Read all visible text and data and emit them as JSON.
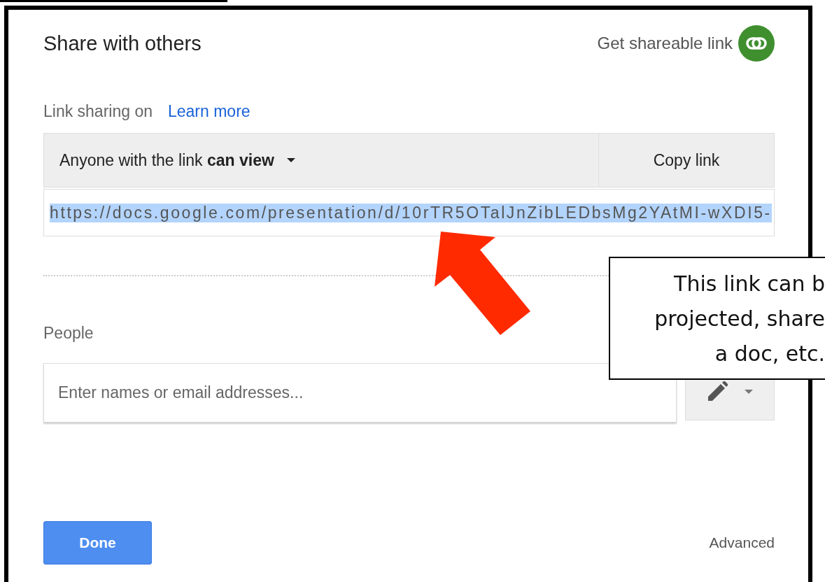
{
  "dialog": {
    "title": "Share with others",
    "shareable_link": {
      "label": "Get shareable link"
    },
    "link_sharing": {
      "status": "Link sharing on",
      "learn_more": "Learn more"
    },
    "access": {
      "text": "Anyone with the link **can view**"
    },
    "copy_button": "Copy link",
    "url": {
      "value": "https://docs.google.com/presentation/d/10rTR5OTalJnZibLEDbsMg2YAtMI-wXDI5-",
      "selected": true
    },
    "people": {
      "label": "People",
      "placeholder": "Enter names or email addresses..."
    },
    "done_button": "Done",
    "advanced_link": "Advanced"
  },
  "annotation": {
    "callout": "This link can b\nprojected, share\na doc, etc."
  }
}
